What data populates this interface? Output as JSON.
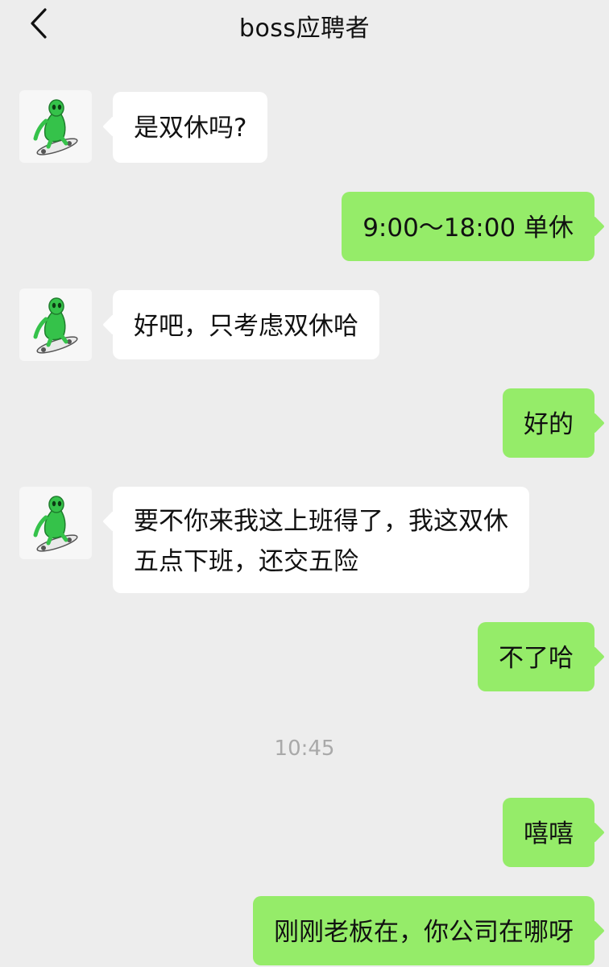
{
  "header": {
    "title": "boss应聘者",
    "back_icon": "chevron-left-icon"
  },
  "colors": {
    "background": "#ededed",
    "incoming_bubble": "#ffffff",
    "outgoing_bubble": "#95ec69",
    "timestamp": "#a9a9a9"
  },
  "messages": [
    {
      "direction": "in",
      "text": "是双休吗?"
    },
    {
      "direction": "out",
      "text": "9:00～18:00 单休"
    },
    {
      "direction": "in",
      "text": "好吧，只考虑双休哈"
    },
    {
      "direction": "out",
      "text": "好的"
    },
    {
      "direction": "in",
      "line1": "要不你来我这上班得了，我这双休",
      "line2": "五点下班，还交五险"
    },
    {
      "direction": "out",
      "text": "不了哈"
    },
    {
      "direction": "out",
      "text": "嘻嘻"
    },
    {
      "direction": "out",
      "text": "刚刚老板在，你公司在哪呀"
    }
  ],
  "timestamp": "10:45",
  "avatar_icon": "alien-skateboard-avatar-icon"
}
